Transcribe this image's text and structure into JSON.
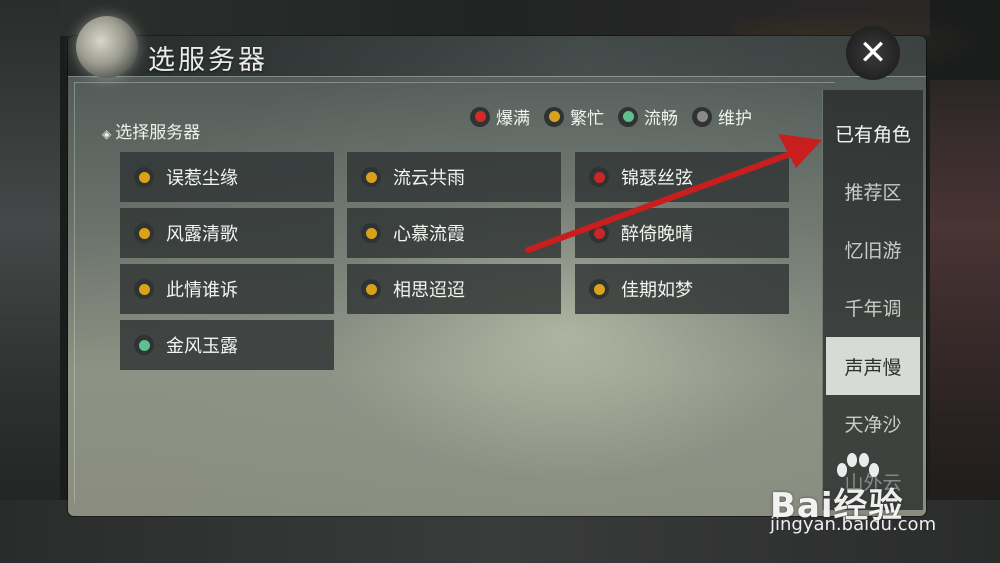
{
  "title": "选服务器",
  "section_label": "选择服务器",
  "legend": [
    {
      "label": "爆满",
      "color": "#d42a2a"
    },
    {
      "label": "繁忙",
      "color": "#d9a21a"
    },
    {
      "label": "流畅",
      "color": "#5fbf8f"
    },
    {
      "label": "维护",
      "color": "#8a8a8a"
    }
  ],
  "servers": [
    {
      "name": "误惹尘缘",
      "color": "#d9a21a"
    },
    {
      "name": "流云共雨",
      "color": "#d9a21a"
    },
    {
      "name": "锦瑟丝弦",
      "color": "#c92626"
    },
    {
      "name": "风露清歌",
      "color": "#d9a21a"
    },
    {
      "name": "心慕流霞",
      "color": "#d9a21a"
    },
    {
      "name": "醉倚晚晴",
      "color": "#c92626"
    },
    {
      "name": "此情谁诉",
      "color": "#d9a21a"
    },
    {
      "name": "相思迢迢",
      "color": "#d9a21a"
    },
    {
      "name": "佳期如梦",
      "color": "#d9a21a"
    },
    {
      "name": "金风玉露",
      "color": "#5fbf8f"
    }
  ],
  "tabs": [
    {
      "label": "已有角色"
    },
    {
      "label": "推荐区"
    },
    {
      "label": "忆旧游"
    },
    {
      "label": "千年调"
    },
    {
      "label": "声声慢",
      "active": true
    },
    {
      "label": "天净沙"
    },
    {
      "label": "山外云"
    }
  ],
  "close_icon": "close-icon",
  "annotation_arrow_color": "#c81e1e",
  "watermark": {
    "logo": "Bai经验",
    "url": "jingyan.baidu.com"
  }
}
